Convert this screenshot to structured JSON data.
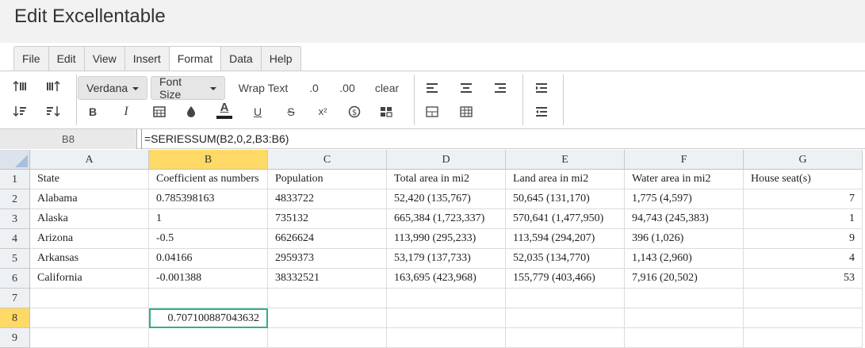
{
  "app": {
    "title": "Edit Excellentable"
  },
  "menu": {
    "tabs": [
      "File",
      "Edit",
      "View",
      "Insert",
      "Format",
      "Data",
      "Help"
    ],
    "active": "Format"
  },
  "toolbar": {
    "font_family": "Verdana",
    "font_size": "Font Size",
    "wrap_text": "Wrap Text",
    "decimal_one": ".0",
    "decimal_two": ".00",
    "clear": "clear",
    "bold": "B",
    "italic": "I",
    "underline": "U",
    "strike": "S",
    "superscript": "x²",
    "text_color": "A"
  },
  "formula_bar": {
    "cell_ref": "B8",
    "formula": "=SERIESSUM(B2,0,2,B3:B6)"
  },
  "grid": {
    "columns": [
      "A",
      "B",
      "C",
      "D",
      "E",
      "F",
      "G"
    ],
    "selected_column": "B",
    "rows": [
      "1",
      "2",
      "3",
      "4",
      "5",
      "6",
      "7",
      "8",
      "9"
    ],
    "selected_row": "8",
    "cells": [
      [
        "State",
        "Coefficient as numbers",
        "Population",
        "Total area in mi2",
        "Land area in mi2",
        "Water area in mi2",
        "House seat(s)"
      ],
      [
        "Alabama",
        "0.785398163",
        "4833722",
        "52,420 (135,767)",
        "50,645 (131,170)",
        "1,775 (4,597)",
        "7"
      ],
      [
        "Alaska",
        "1",
        "735132",
        "665,384 (1,723,337)",
        "570,641 (1,477,950)",
        "94,743 (245,383)",
        "1"
      ],
      [
        "Arizona",
        "-0.5",
        "6626624",
        "113,990 (295,233)",
        "113,594 (294,207)",
        "396 (1,026)",
        "9"
      ],
      [
        "Arkansas",
        "0.04166",
        "2959373",
        "53,179 (137,733)",
        "52,035 (134,770)",
        "1,143 (2,960)",
        "4"
      ],
      [
        "California",
        "-0.001388",
        "38332521",
        "163,695 (423,968)",
        "155,779 (403,466)",
        "7,916 (20,502)",
        "53"
      ],
      [
        "",
        "",
        "",
        "",
        "",
        "",
        ""
      ],
      [
        "",
        "0.707100887043632",
        "",
        "",
        "",
        "",
        ""
      ],
      [
        "",
        "",
        "",
        "",
        "",
        "",
        ""
      ]
    ]
  },
  "colors": {
    "selection": "#2fb08a",
    "header_highlight": "#ffd966"
  }
}
